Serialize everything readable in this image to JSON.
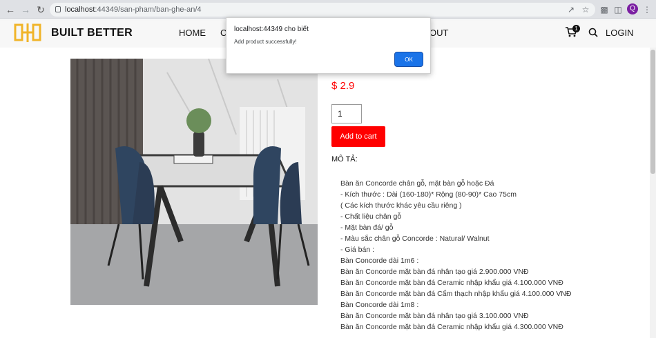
{
  "browser": {
    "host": "localhost",
    "path": ":44349/san-pham/ban-ghe-an/4",
    "profile_initial": "Q"
  },
  "site": {
    "brand": "BUILT BETTER",
    "menu": [
      "HOME",
      "C",
      "OUT"
    ],
    "cart_count": "1",
    "login_label": "LOGIN"
  },
  "product": {
    "price": "$ 2.9",
    "quantity": "1",
    "add_to_cart_label": "Add to cart",
    "description_title": "MÔ TẢ:",
    "description_lines": [
      "Bàn ăn Concorde chân gỗ, mặt bàn gỗ hoặc Đá",
      "- Kích thước : Dài (160-180)* Rộng (80-90)* Cao 75cm",
      "( Các kích thước khác yêu cầu riêng )",
      "- Chất liệu chân gỗ",
      "- Mặt bàn đá/ gỗ",
      "- Màu sắc chân gỗ Concorde : Natural/ Walnut",
      "- Giá bán :",
      "Bàn Concorde dài 1m6 :",
      "Bàn ăn Concorde mặt bàn đá nhân tạo giá 2.900.000 VNĐ",
      "Bàn ăn Concorde mặt bàn đá Ceramic nhập khẩu giá 4.100.000 VNĐ",
      "Bàn ăn Concorde mặt bàn đá Cẩm thạch nhập khẩu giá 4.100.000 VNĐ",
      "Bàn Concorde dài 1m8 :",
      "Bàn ăn Concorde mặt bàn đá nhân tạo giá 3.100.000 VNĐ",
      "Bàn ăn Concorde mặt bàn đá Ceramic nhập khẩu giá 4.300.000 VNĐ"
    ]
  },
  "dialog": {
    "title": "localhost:44349 cho biết",
    "message": "Add product successfully!",
    "ok_label": "OK"
  },
  "colors": {
    "accent_red": "#ff0000",
    "logo_yellow": "#f0b429",
    "dialog_button": "#1a73e8"
  }
}
